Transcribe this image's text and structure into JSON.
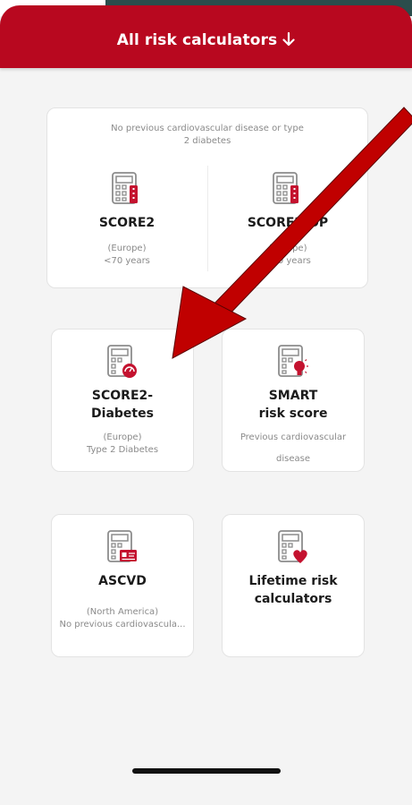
{
  "header": {
    "title": "All risk calculators",
    "arrow_icon": "arrow-down-icon"
  },
  "colors": {
    "brand_red": "#b8081f",
    "accent_red": "#c4122f",
    "arrow_red": "#c00000"
  },
  "top_card": {
    "subtitle": "No previous cardiovascular disease or type 2 diabetes",
    "left": {
      "name": "SCORE2",
      "region": "(Europe)",
      "criteria": "<70 years"
    },
    "right": {
      "name": "SCORE2-OP",
      "region": "(Europe)",
      "criteria": "≥70 years"
    }
  },
  "cards": [
    {
      "name_line1": "SCORE2-",
      "name_line2": "Diabetes",
      "region": "(Europe)",
      "criteria": "Type 2 Diabetes",
      "icon": "calculator-gauge-icon"
    },
    {
      "name_line1": "SMART",
      "name_line2": "risk score",
      "region": "Previous cardiovascular",
      "criteria": "disease",
      "icon": "calculator-bulb-icon"
    },
    {
      "name_line1": "ASCVD",
      "region": "(North America)",
      "criteria": "No previous cardiovascula...",
      "icon": "calculator-card-icon"
    },
    {
      "name_line1": "Lifetime risk",
      "name_line2": "calculators",
      "icon": "calculator-heart-icon"
    }
  ]
}
